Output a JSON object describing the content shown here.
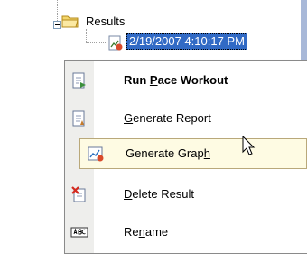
{
  "tree": {
    "folder_label": "Results",
    "selected_item": "2/19/2007 4:10:17 PM",
    "folder_icon": "folder-icon",
    "result_icon": "result-document-icon"
  },
  "menu": {
    "items": [
      {
        "label_pre": "Run ",
        "label_key": "P",
        "label_post": "ace Workout",
        "icon": "run-workout-icon",
        "bold": true
      },
      {
        "label_pre": "",
        "label_key": "G",
        "label_post": "enerate Report",
        "icon": "report-icon",
        "bold": false
      },
      {
        "label_pre": "Generate Grap",
        "label_key": "h",
        "label_post": "",
        "icon": "graph-icon",
        "bold": false
      },
      {
        "label_pre": "",
        "label_key": "D",
        "label_post": "elete Result",
        "icon": "delete-icon",
        "bold": false
      },
      {
        "label_pre": "Re",
        "label_key": "n",
        "label_post": "ame",
        "icon": "rename-icon",
        "bold": false
      }
    ]
  },
  "colors": {
    "selection": "#316ac5",
    "hover_bg": "#fefbe3",
    "hover_border": "#b9a87a",
    "gutter": "#eeeeec"
  }
}
